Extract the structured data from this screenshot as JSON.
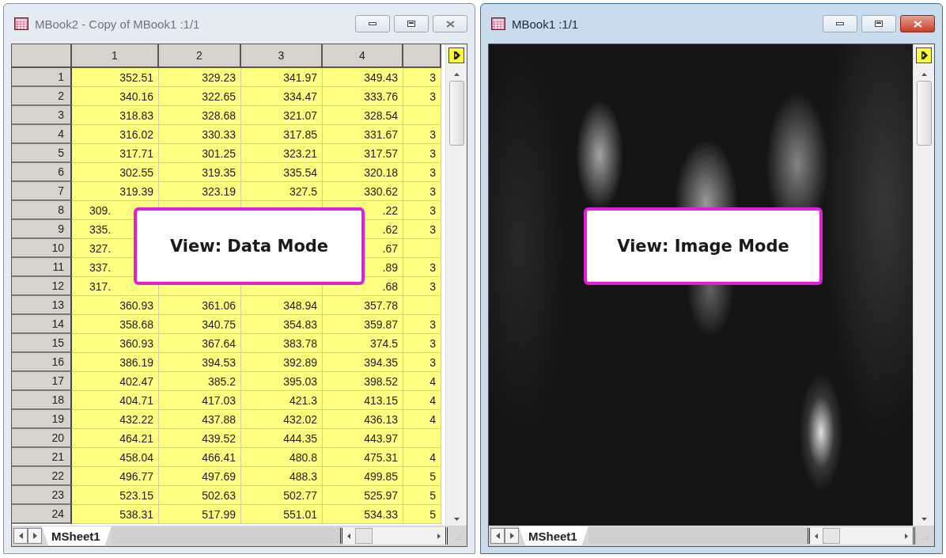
{
  "windows": [
    {
      "kind": "worksheet",
      "title": "MBook2 - Copy of MBook1 :1/1",
      "active": false,
      "columns": [
        "1",
        "2",
        "3",
        "4"
      ],
      "rows": [
        {
          "label": "1",
          "covered": false,
          "cells": [
            "352.51",
            "329.23",
            "341.97",
            "349.43",
            "3"
          ]
        },
        {
          "label": "2",
          "covered": false,
          "cells": [
            "340.16",
            "322.65",
            "334.47",
            "333.76",
            "3"
          ]
        },
        {
          "label": "3",
          "covered": false,
          "cells": [
            "318.83",
            "328.68",
            "321.07",
            "328.54",
            null
          ]
        },
        {
          "label": "4",
          "covered": false,
          "cells": [
            "316.02",
            "330.33",
            "317.85",
            "331.67",
            "3"
          ]
        },
        {
          "label": "5",
          "covered": false,
          "cells": [
            "317.71",
            "301.25",
            "323.21",
            "317.57",
            "3"
          ]
        },
        {
          "label": "6",
          "covered": false,
          "cells": [
            "302.55",
            "319.35",
            "335.54",
            "320.18",
            "3"
          ]
        },
        {
          "label": "7",
          "covered": false,
          "cells": [
            "319.39",
            "323.19",
            "327.5",
            "330.62",
            "3"
          ]
        },
        {
          "label": "8",
          "covered": true,
          "cells": [
            "309.",
            null,
            null,
            ".22",
            "3"
          ]
        },
        {
          "label": "9",
          "covered": true,
          "cells": [
            "335.",
            null,
            null,
            ".62",
            "3"
          ]
        },
        {
          "label": "10",
          "covered": true,
          "cells": [
            "327.",
            null,
            null,
            ".67",
            null
          ]
        },
        {
          "label": "11",
          "covered": true,
          "cells": [
            "337.",
            null,
            null,
            ".89",
            "3"
          ]
        },
        {
          "label": "12",
          "covered": true,
          "cells": [
            "317.",
            null,
            null,
            ".68",
            "3"
          ]
        },
        {
          "label": "13",
          "covered": false,
          "cells": [
            "360.93",
            "361.06",
            "348.94",
            "357.78",
            null
          ]
        },
        {
          "label": "14",
          "covered": false,
          "cells": [
            "358.68",
            "340.75",
            "354.83",
            "359.87",
            "3"
          ]
        },
        {
          "label": "15",
          "covered": false,
          "cells": [
            "360.93",
            "367.64",
            "383.78",
            "374.5",
            "3"
          ]
        },
        {
          "label": "16",
          "covered": false,
          "cells": [
            "386.19",
            "394.53",
            "392.89",
            "394.35",
            "3"
          ]
        },
        {
          "label": "17",
          "covered": false,
          "cells": [
            "402.47",
            "385.2",
            "395.03",
            "398.52",
            "4"
          ]
        },
        {
          "label": "18",
          "covered": false,
          "cells": [
            "404.71",
            "417.03",
            "421.3",
            "413.15",
            "4"
          ]
        },
        {
          "label": "19",
          "covered": false,
          "cells": [
            "432.22",
            "437.88",
            "432.02",
            "436.13",
            "4"
          ]
        },
        {
          "label": "20",
          "covered": false,
          "cells": [
            "464.21",
            "439.52",
            "444.35",
            "443.97",
            null
          ]
        },
        {
          "label": "21",
          "covered": false,
          "cells": [
            "458.04",
            "466.41",
            "480.8",
            "475.31",
            "4"
          ]
        },
        {
          "label": "22",
          "covered": false,
          "cells": [
            "496.77",
            "497.69",
            "488.3",
            "499.85",
            "5"
          ]
        },
        {
          "label": "23",
          "covered": false,
          "cells": [
            "523.15",
            "502.63",
            "502.77",
            "525.97",
            "5"
          ]
        },
        {
          "label": "24",
          "covered": false,
          "cells": [
            "538.31",
            "517.99",
            "551.01",
            "534.33",
            "5"
          ]
        }
      ],
      "callout": "View: Data Mode",
      "sheet_tab": "MSheet1"
    },
    {
      "kind": "image",
      "title": "MBook1 :1/1",
      "active": true,
      "callout": "View: Image Mode",
      "sheet_tab": "MSheet1"
    }
  ]
}
